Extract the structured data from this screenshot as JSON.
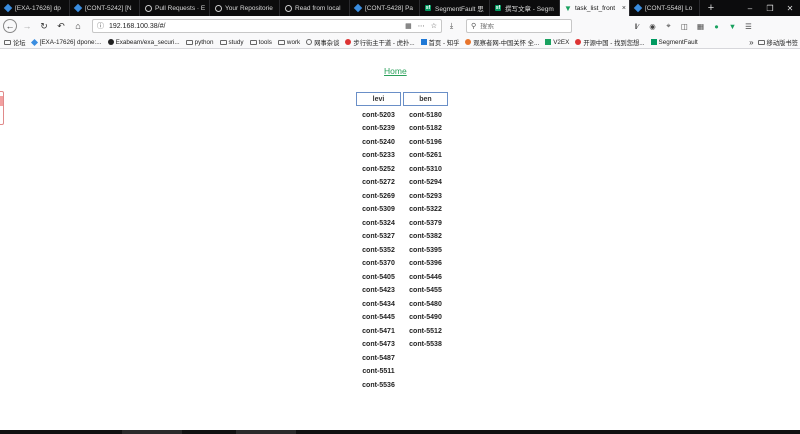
{
  "tabs": [
    {
      "icon": "jira-diamond-icon",
      "title": "[EXA-17626] dp",
      "active": false
    },
    {
      "icon": "jira-diamond-icon",
      "title": "[CONT-5242] [N",
      "active": false
    },
    {
      "icon": "github-icon",
      "title": "Pull Requests · E",
      "active": false
    },
    {
      "icon": "github-icon",
      "title": "Your Repositorie",
      "active": false
    },
    {
      "icon": "github-icon",
      "title": "Read from local",
      "active": false
    },
    {
      "icon": "jira-diamond-icon",
      "title": "[CONT-5428] Pa",
      "active": false
    },
    {
      "icon": "segmentfault-icon",
      "title": "SegmentFault 思",
      "active": false
    },
    {
      "icon": "segmentfault-icon",
      "title": "撰写文章 - Segm",
      "active": false
    },
    {
      "icon": "vue-icon",
      "title": "task_list_front",
      "active": true
    },
    {
      "icon": "jira-diamond-icon",
      "title": "[CONT-5548] Lo",
      "active": false
    }
  ],
  "nav": {
    "url": "192.168.100.38/#/",
    "search_placeholder": "搜索"
  },
  "bookmarks": [
    {
      "icon": "folder",
      "label": "论坛"
    },
    {
      "icon": "dia",
      "label": "[EXA-17626] dpone:..."
    },
    {
      "icon": "gh",
      "label": "Exabeam/exa_securi..."
    },
    {
      "icon": "folder",
      "label": "python"
    },
    {
      "icon": "folder",
      "label": "study"
    },
    {
      "icon": "folder",
      "label": "tools"
    },
    {
      "icon": "folder",
      "label": "work"
    },
    {
      "icon": "globe",
      "label": "网事杂谈"
    },
    {
      "icon": "red",
      "label": "步行街主干道 - 虎扑..."
    },
    {
      "icon": "blue",
      "label": "首页 - 知乎"
    },
    {
      "icon": "orange",
      "label": "观察者网-中国关怀 全..."
    },
    {
      "icon": "green",
      "label": "V2EX"
    },
    {
      "icon": "red",
      "label": "开源中国 - 找到您想..."
    },
    {
      "icon": "sf",
      "label": "SegmentFault"
    }
  ],
  "bookmarks_mobile": "移动版书签",
  "page": {
    "home_link": "Home",
    "columns": [
      "levi",
      "ben"
    ],
    "levi": [
      "cont-5203",
      "cont-5239",
      "cont-5240",
      "cont-5233",
      "cont-5252",
      "cont-5272",
      "cont-5269",
      "cont-5309",
      "cont-5324",
      "cont-5327",
      "cont-5352",
      "cont-5370",
      "cont-5405",
      "cont-5423",
      "cont-5434",
      "cont-5445",
      "cont-5471",
      "cont-5473",
      "cont-5487",
      "cont-5511",
      "cont-5536"
    ],
    "ben": [
      "cont-5180",
      "cont-5182",
      "cont-5196",
      "cont-5261",
      "cont-5310",
      "cont-5294",
      "cont-5293",
      "cont-5322",
      "cont-5379",
      "cont-5382",
      "cont-5395",
      "cont-5396",
      "cont-5446",
      "cont-5455",
      "cont-5480",
      "cont-5490",
      "cont-5512",
      "cont-5538"
    ]
  }
}
